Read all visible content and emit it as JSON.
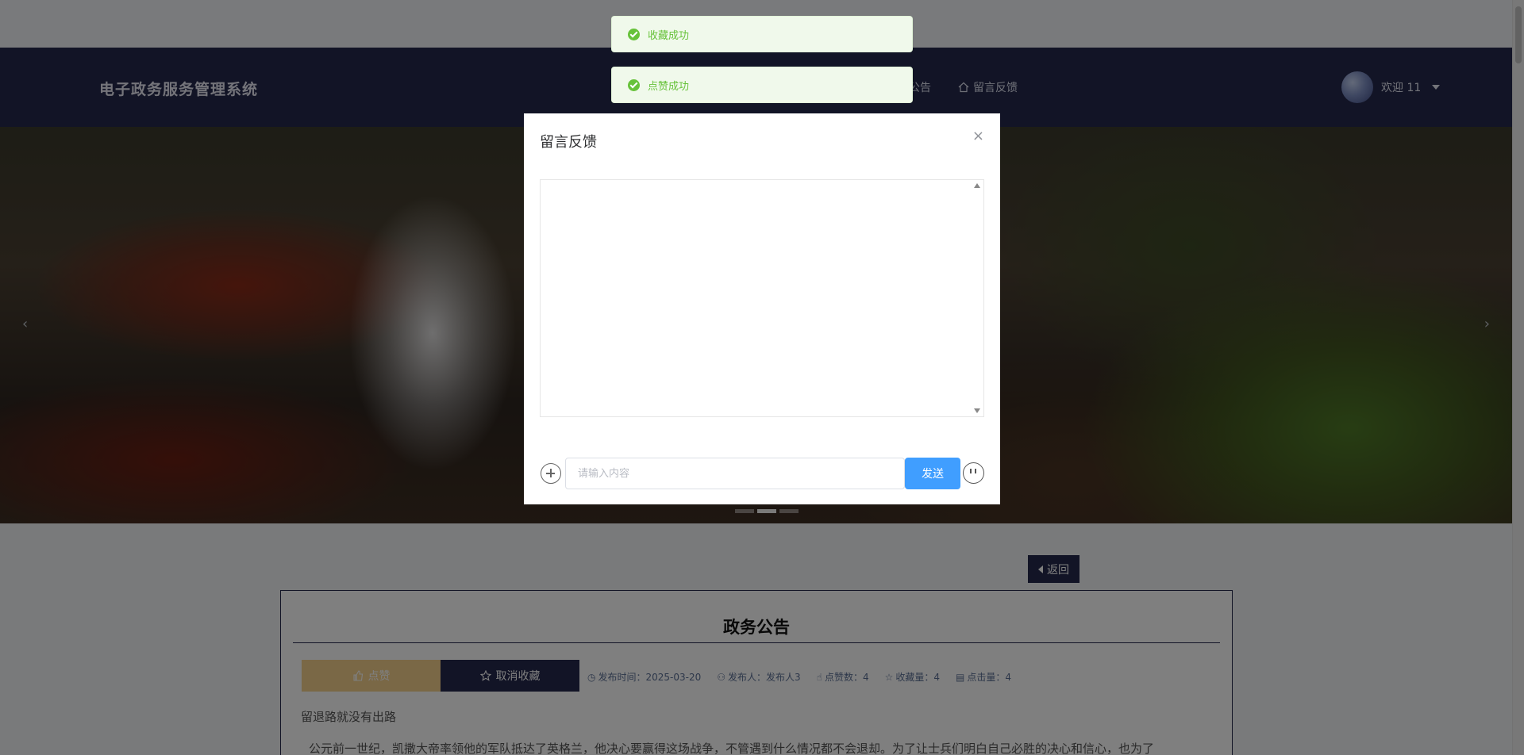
{
  "header": {
    "brand": "电子政务服务管理系统",
    "nav": {
      "notice_partial": "公告",
      "feedback": "留言反馈"
    },
    "user": {
      "greeting": "欢迎 11"
    }
  },
  "banner": {
    "prev": "‹",
    "next": "›"
  },
  "back_button": "返回",
  "article": {
    "title": "政务公告",
    "like_button": "点赞",
    "unfavorite_button": "取消收藏",
    "meta": {
      "publish_time": "发布时间：2025-03-20",
      "publisher": "发布人：发布人3",
      "likes": "点赞数：4",
      "favorites": "收藏量：4",
      "clicks": "点击量：4"
    },
    "subtitle": "留退路就没有出路",
    "body": "公元前一世纪，凯撒大帝率领他的军队抵达了英格兰，他决心要赢得这场战争，不管遇到什么情况都不会退却。为了让士兵们明白自己必胜的决心和信心，也为了"
  },
  "toasts": [
    {
      "text": "收藏成功"
    },
    {
      "text": "点赞成功"
    }
  ],
  "dialog": {
    "title": "留言反馈",
    "close": "×",
    "input_placeholder": "请输入内容",
    "send_label": "发送"
  },
  "colors": {
    "primary_dark": "#25294d",
    "send_blue": "#409eff",
    "success_green": "#67c23a",
    "like_gold": "#f4d08c"
  }
}
